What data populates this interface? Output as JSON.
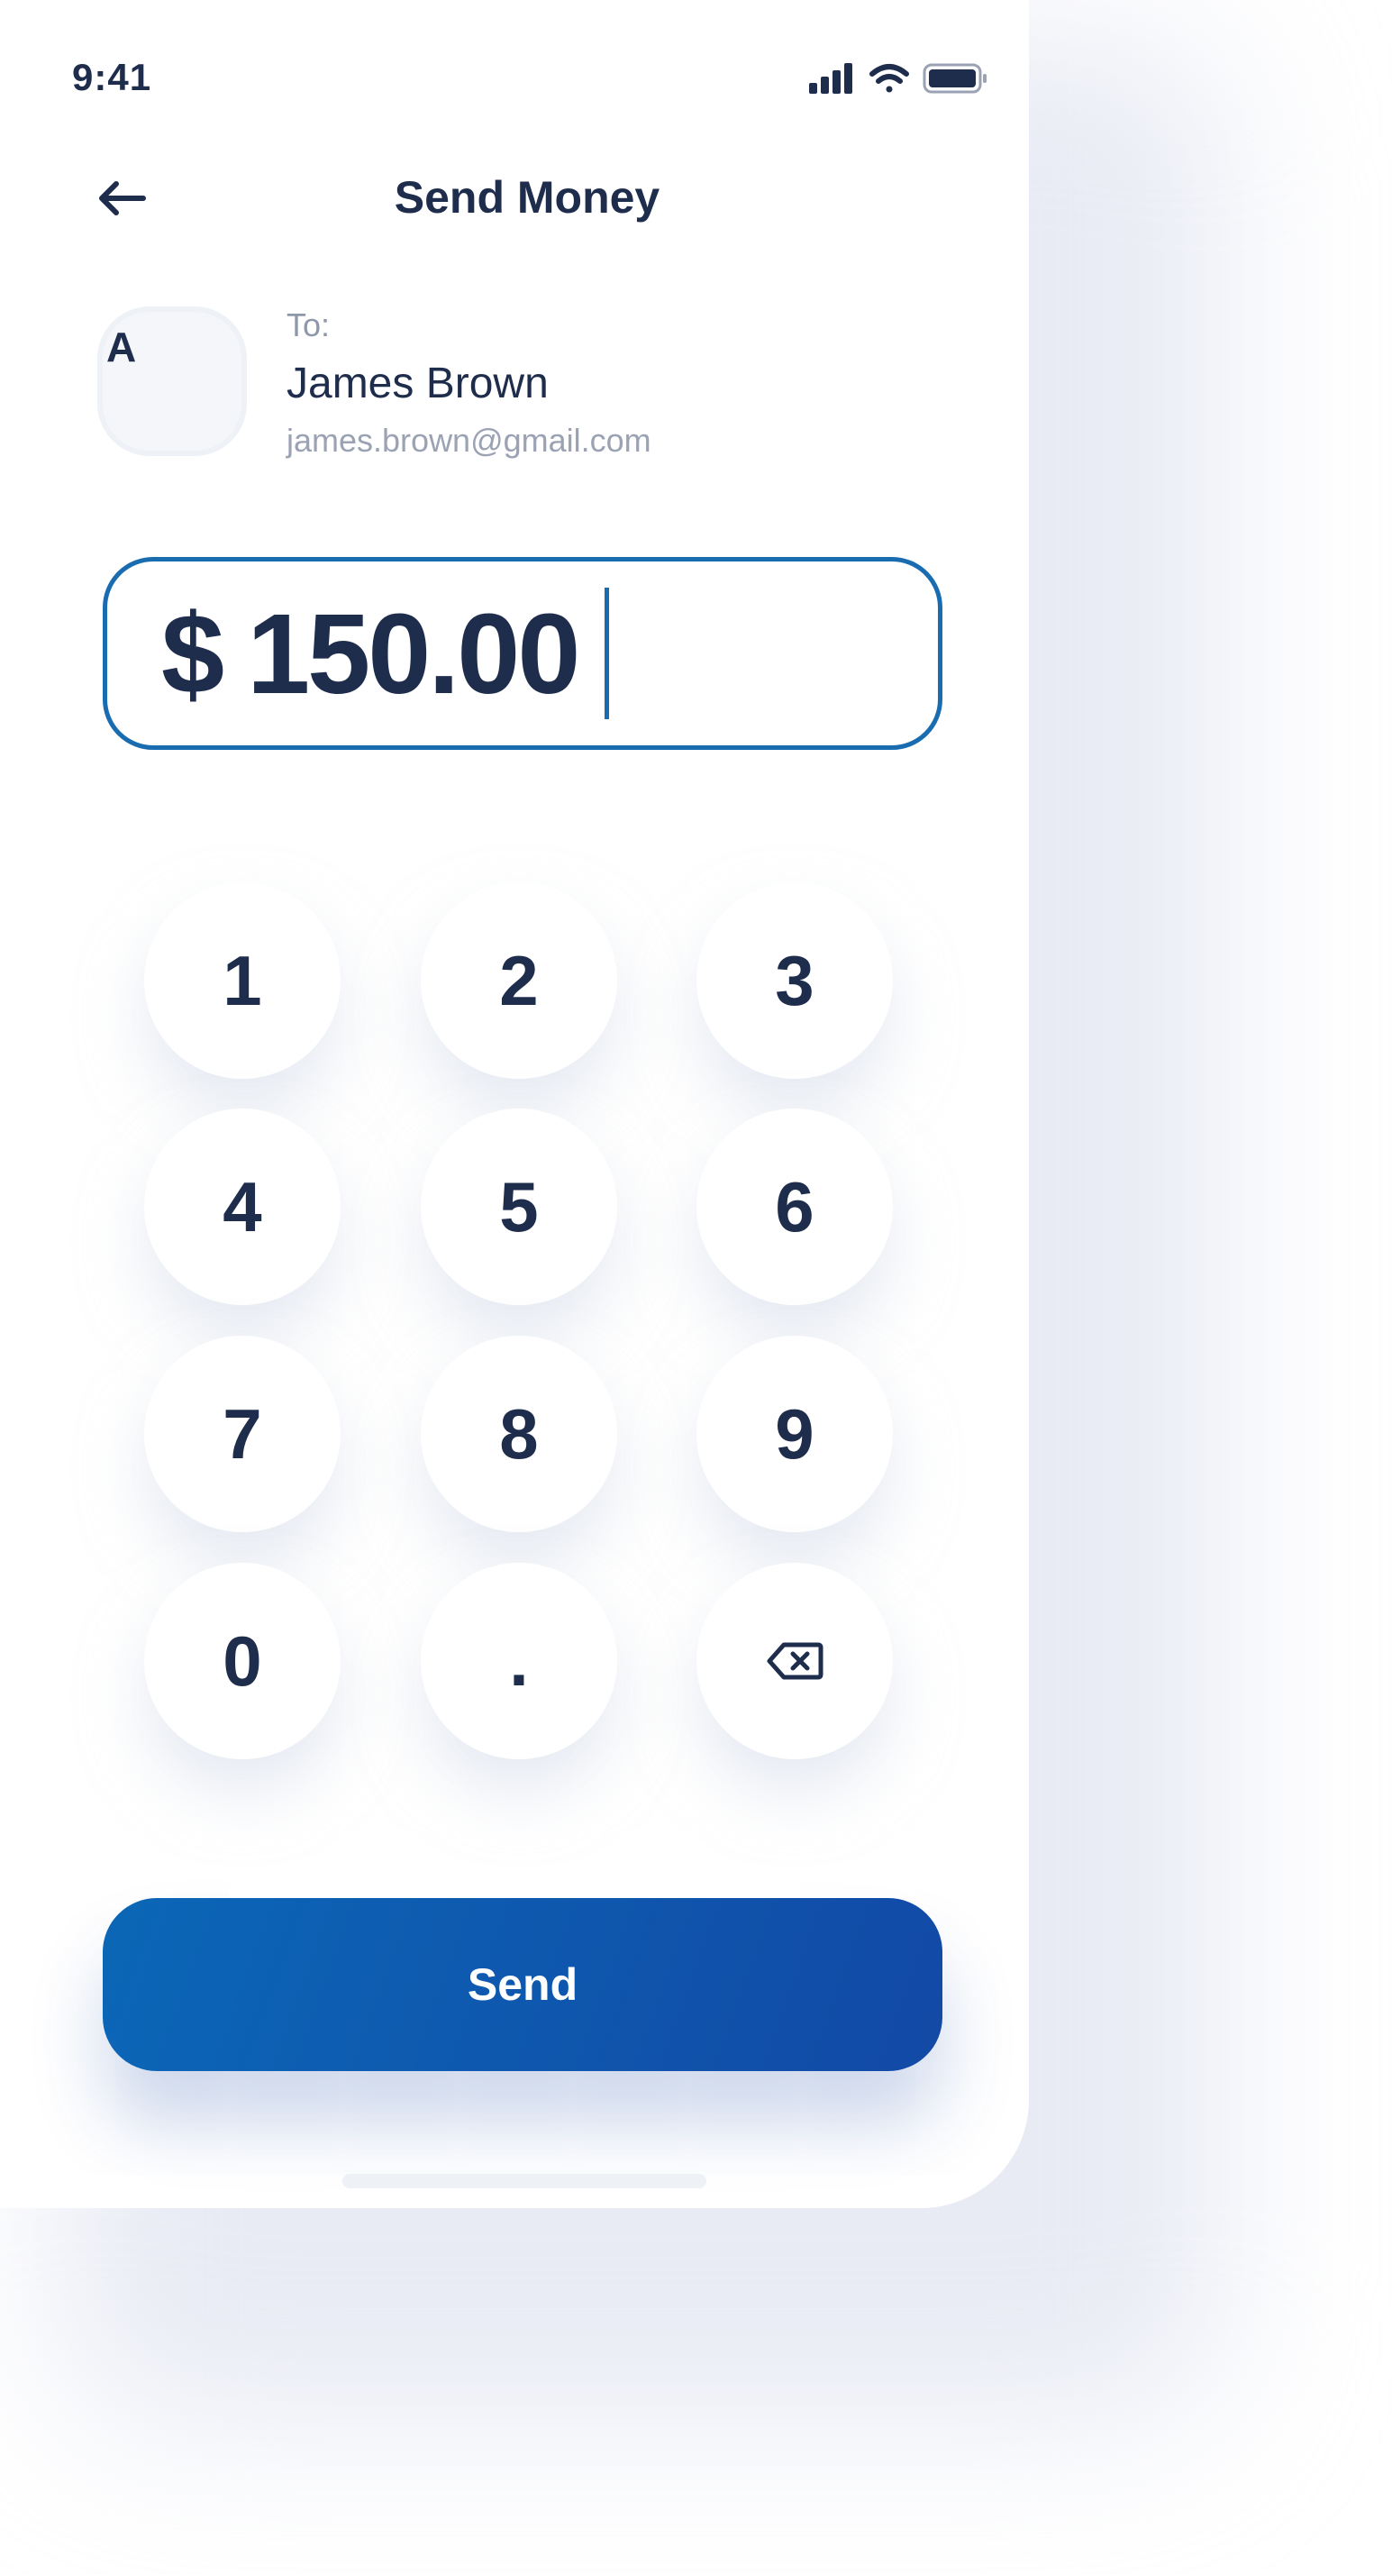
{
  "status_bar": {
    "time": "9:41",
    "icons": [
      "signal-icon",
      "wifi-icon",
      "battery-icon"
    ]
  },
  "header": {
    "title": "Send Money",
    "back_icon": "arrow-left-icon"
  },
  "recipient": {
    "avatar_letter": "A",
    "to_label": "To:",
    "name": "James Brown",
    "email": "james.brown@gmail.com"
  },
  "amount": {
    "currency": "$",
    "value": "150.00"
  },
  "keypad": {
    "keys": [
      "1",
      "2",
      "3",
      "4",
      "5",
      "6",
      "7",
      "8",
      "9",
      "0",
      ".",
      "backspace-icon"
    ]
  },
  "actions": {
    "send_label": "Send"
  },
  "colors": {
    "text": "#1f2d4d",
    "accent": "#1a6cb0",
    "button_gradient_start": "#0b67b7",
    "button_gradient_end": "#1249a6"
  }
}
